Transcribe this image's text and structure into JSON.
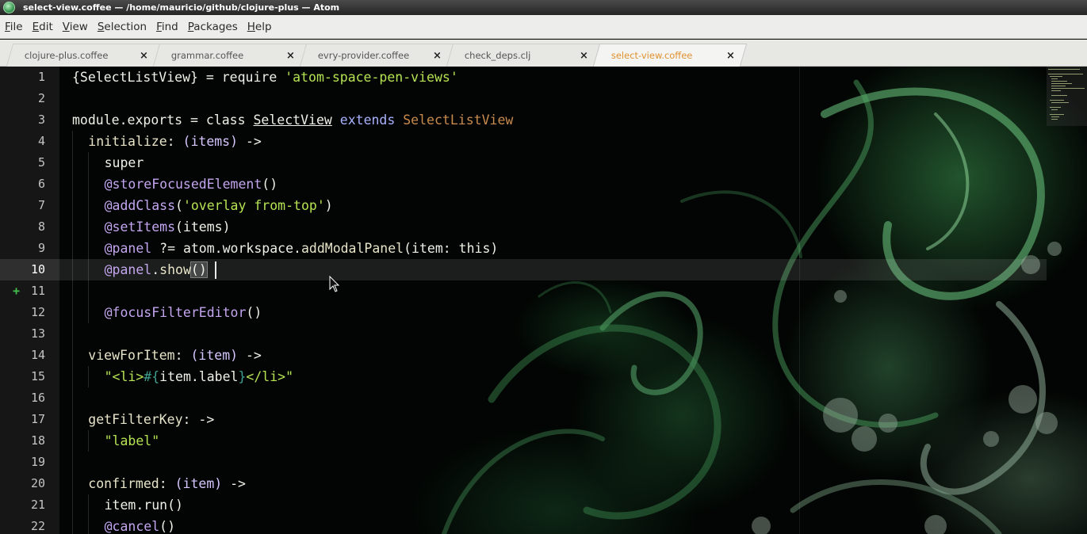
{
  "window": {
    "title": "select-view.coffee — /home/mauricio/github/clojure-plus — Atom"
  },
  "menu": {
    "items": [
      {
        "mnemonic": "F",
        "rest": "ile"
      },
      {
        "mnemonic": "E",
        "rest": "dit"
      },
      {
        "mnemonic": "V",
        "rest": "iew"
      },
      {
        "mnemonic": "S",
        "rest": "election"
      },
      {
        "mnemonic": "F",
        "rest": "ind"
      },
      {
        "mnemonic": "P",
        "rest": "ackages"
      },
      {
        "mnemonic": "H",
        "rest": "elp"
      }
    ]
  },
  "tabs": [
    {
      "label": "clojure-plus.coffee",
      "close": "×",
      "active": false
    },
    {
      "label": "grammar.coffee",
      "close": "×",
      "active": false
    },
    {
      "label": "evry-provider.coffee",
      "close": "×",
      "active": false
    },
    {
      "label": "check_deps.clj",
      "close": "×",
      "active": false
    },
    {
      "label": "select-view.coffee",
      "close": "×",
      "active": true
    }
  ],
  "editor": {
    "current_line": 10,
    "git_added_line": 11,
    "git_added_marker": "+",
    "line_numbers": [
      "1",
      "2",
      "3",
      "4",
      "5",
      "6",
      "7",
      "8",
      "9",
      "10",
      "11",
      "12",
      "13",
      "14",
      "15",
      "16",
      "17",
      "18",
      "19",
      "20",
      "21",
      "22"
    ],
    "lines": [
      {
        "indent": 0,
        "tokens": [
          [
            "{SelectListView} = require ",
            "plain"
          ],
          [
            "'atom-space-pen-views'",
            "str"
          ]
        ]
      },
      {
        "indent": 0,
        "tokens": []
      },
      {
        "indent": 0,
        "tokens": [
          [
            "module.exports = class ",
            "plain"
          ],
          [
            "SelectView",
            "cls"
          ],
          [
            " ",
            "plain"
          ],
          [
            "extends",
            "ext"
          ],
          [
            " ",
            "plain"
          ],
          [
            "SelectListView",
            "super"
          ]
        ]
      },
      {
        "indent": 1,
        "tokens": [
          [
            "initialize",
            "fn"
          ],
          [
            ": ",
            "plain"
          ],
          [
            "(items)",
            "param"
          ],
          [
            " ->",
            "plain"
          ]
        ]
      },
      {
        "indent": 2,
        "tokens": [
          [
            "super",
            "plain"
          ]
        ]
      },
      {
        "indent": 2,
        "tokens": [
          [
            "@storeFocusedElement",
            "ivar"
          ],
          [
            "()",
            "plain"
          ]
        ]
      },
      {
        "indent": 2,
        "tokens": [
          [
            "@addClass",
            "ivar"
          ],
          [
            "(",
            "plain"
          ],
          [
            "'overlay from-top'",
            "str"
          ],
          [
            ")",
            "plain"
          ]
        ]
      },
      {
        "indent": 2,
        "tokens": [
          [
            "@setItems",
            "ivar"
          ],
          [
            "(items)",
            "plain"
          ]
        ]
      },
      {
        "indent": 2,
        "tokens": [
          [
            "@panel",
            "ivar"
          ],
          [
            " ?= atom.workspace.",
            "plain"
          ],
          [
            "addModalPanel",
            "fn"
          ],
          [
            "(item: ",
            "plain"
          ],
          [
            "this",
            "plain"
          ],
          [
            ")",
            "plain"
          ]
        ]
      },
      {
        "indent": 2,
        "tokens": [
          [
            "@panel",
            "ivar"
          ],
          [
            ".",
            "plain"
          ],
          [
            "show",
            "fn"
          ],
          [
            "()",
            "match"
          ]
        ]
      },
      {
        "indent": 2,
        "tokens": []
      },
      {
        "indent": 2,
        "tokens": [
          [
            "@focusFilterEditor",
            "ivar"
          ],
          [
            "()",
            "plain"
          ]
        ]
      },
      {
        "indent": 1,
        "tokens": []
      },
      {
        "indent": 1,
        "tokens": [
          [
            "viewForItem",
            "fn"
          ],
          [
            ": ",
            "plain"
          ],
          [
            "(item)",
            "param"
          ],
          [
            " ->",
            "plain"
          ]
        ]
      },
      {
        "indent": 2,
        "tokens": [
          [
            "\"<li>",
            "str"
          ],
          [
            "#{",
            "interp"
          ],
          [
            "item.label",
            "plain"
          ],
          [
            "}",
            "interp"
          ],
          [
            "</li>\"",
            "str"
          ]
        ]
      },
      {
        "indent": 1,
        "tokens": []
      },
      {
        "indent": 1,
        "tokens": [
          [
            "getFilterKey",
            "fn"
          ],
          [
            ": ->",
            "plain"
          ]
        ]
      },
      {
        "indent": 2,
        "tokens": [
          [
            "\"label\"",
            "str"
          ]
        ]
      },
      {
        "indent": 1,
        "tokens": []
      },
      {
        "indent": 1,
        "tokens": [
          [
            "confirmed",
            "fn"
          ],
          [
            ": ",
            "plain"
          ],
          [
            "(item)",
            "param"
          ],
          [
            " ->",
            "plain"
          ]
        ]
      },
      {
        "indent": 2,
        "tokens": [
          [
            "item.run()",
            "plain"
          ]
        ]
      },
      {
        "indent": 2,
        "tokens": [
          [
            "@cancel",
            "ivar"
          ],
          [
            "()",
            "plain"
          ]
        ]
      }
    ]
  },
  "colors": {
    "tab_active_text": "#e0922f",
    "string": "#b6e354",
    "git_added": "#44c14d",
    "gutter_bg": "#161616"
  }
}
